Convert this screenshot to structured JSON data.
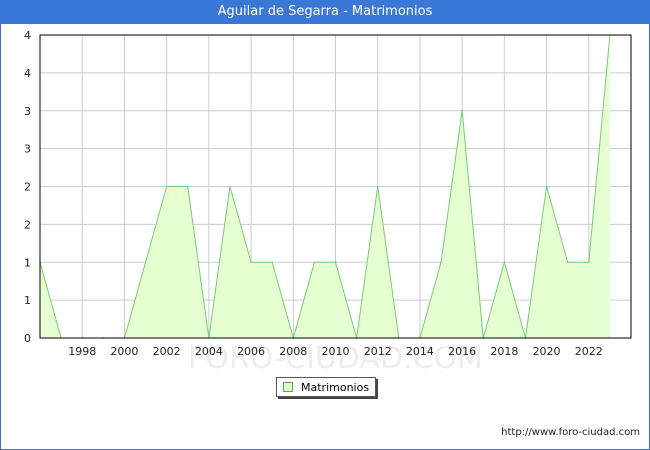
{
  "title": "Aguilar de Segarra - Matrimonios",
  "source": "http://www.foro-ciudad.com",
  "watermark": "FORO-CIUDAD.COM",
  "colors": {
    "titlebar": "#3a78d8",
    "fill": "#e6ffd0",
    "line": "#77cc77",
    "grid": "#cccccc"
  },
  "chart_data": {
    "type": "area",
    "title": "Aguilar de Segarra - Matrimonios",
    "xlabel": "",
    "ylabel": "",
    "x": [
      1996,
      1997,
      1998,
      1999,
      2000,
      2001,
      2002,
      2003,
      2004,
      2005,
      2006,
      2007,
      2008,
      2009,
      2010,
      2011,
      2012,
      2013,
      2014,
      2015,
      2016,
      2017,
      2018,
      2019,
      2020,
      2021,
      2022,
      2023
    ],
    "series": [
      {
        "name": "Matrimonios",
        "values": [
          1,
          0,
          0,
          0,
          0,
          1,
          2,
          2,
          0,
          2,
          1,
          1,
          0,
          1,
          1,
          0,
          2,
          0,
          0,
          1,
          3,
          0,
          1,
          0,
          2,
          1,
          1,
          4
        ]
      }
    ],
    "xticks": [
      "1998",
      "2000",
      "2002",
      "2004",
      "2006",
      "2008",
      "2010",
      "2012",
      "2014",
      "2016",
      "2018",
      "2020",
      "2022"
    ],
    "yticks": [
      "0",
      "1",
      "1",
      "2",
      "2",
      "3",
      "3",
      "4",
      "4"
    ],
    "xlim": [
      1996,
      2024
    ],
    "ylim": [
      0,
      4
    ],
    "grid": true,
    "legend_position": "bottom-center"
  }
}
